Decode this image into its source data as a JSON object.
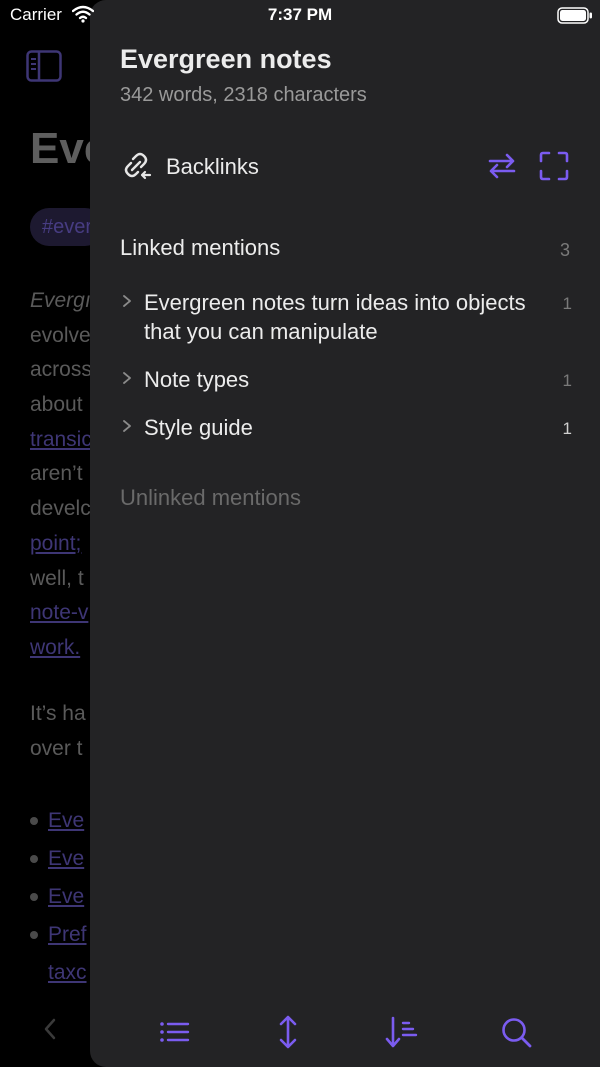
{
  "status_bar": {
    "carrier": "Carrier",
    "time": "7:37 PM"
  },
  "background_note": {
    "title": "Eve",
    "tag": "#ever",
    "paragraph1": [
      "Evergı",
      "evolve",
      "across",
      "about",
      "transic",
      "aren’t",
      "develc",
      "point;",
      "well, t",
      "note-v",
      "work."
    ],
    "paragraph2": [
      "It’s ha",
      "over t"
    ],
    "list_items": [
      "Eve",
      "Eve",
      "Eve",
      "Pref",
      "taxc"
    ]
  },
  "drawer": {
    "title": "Evergreen notes",
    "stats": "342 words, 2318 characters",
    "backlinks_label": "Backlinks",
    "linked_mentions": {
      "label": "Linked mentions",
      "count": "3",
      "items": [
        {
          "text": "Evergreen notes turn ideas into objects that you can manipulate",
          "count": "1"
        },
        {
          "text": "Note types",
          "count": "1"
        },
        {
          "text": "Style guide",
          "count": "1"
        }
      ]
    },
    "unlinked_mentions": {
      "label": "Unlinked mentions"
    }
  },
  "toolbar": {
    "buttons": [
      "list-icon",
      "expand-vertical-icon",
      "sort-icon",
      "search-icon"
    ]
  },
  "colors": {
    "accent": "#7b5cf0",
    "drawer_bg": "#232325",
    "text": "#ececec",
    "muted": "#7a7a7a"
  }
}
